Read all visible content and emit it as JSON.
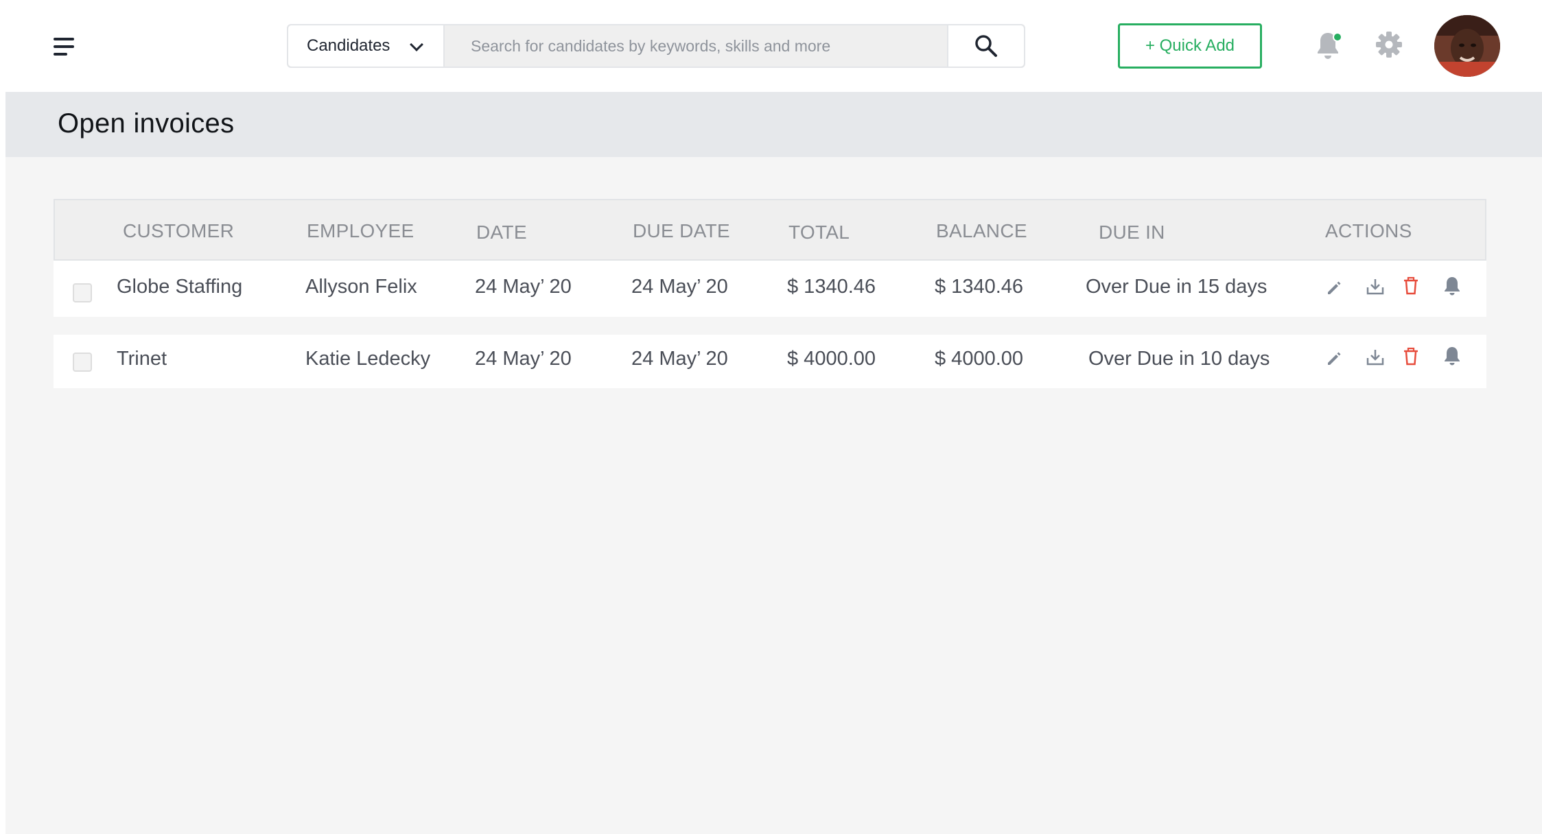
{
  "header": {
    "search": {
      "category": "Candidates",
      "placeholder": "Search for candidates by keywords, skills and more"
    },
    "quick_add_label": "+ Quick Add",
    "notification_dot_color": "#27ae60",
    "icons": [
      "menu-icon",
      "chevron-down-icon",
      "search-icon",
      "bell-icon",
      "gear-icon"
    ]
  },
  "page": {
    "title": "Open invoices"
  },
  "table": {
    "columns": [
      "CUSTOMER",
      "EMPLOYEE",
      "DATE",
      "DUE DATE",
      "TOTAL",
      "BALANCE",
      "DUE IN",
      "ACTIONS"
    ],
    "rows": [
      {
        "customer": "Globe Staffing",
        "employee": "Allyson Felix",
        "date": "24 May’ 20",
        "due_date": "24 May’ 20",
        "total": "$ 1340.46",
        "balance": "$ 1340.46",
        "due_in": "Over Due in 15 days"
      },
      {
        "customer": "Trinet",
        "employee": "Katie Ledecky",
        "date": "24 May’ 20",
        "due_date": "24 May’ 20",
        "total": "$ 4000.00",
        "balance": "$ 4000.00",
        "due_in": "Over Due in 10 days"
      }
    ],
    "action_icons": [
      "edit-icon",
      "download-icon",
      "delete-icon",
      "reminder-bell-icon"
    ]
  },
  "colors": {
    "accent_green": "#27ae60",
    "delete_red": "#e74c3c",
    "action_gray": "#7e8794"
  }
}
